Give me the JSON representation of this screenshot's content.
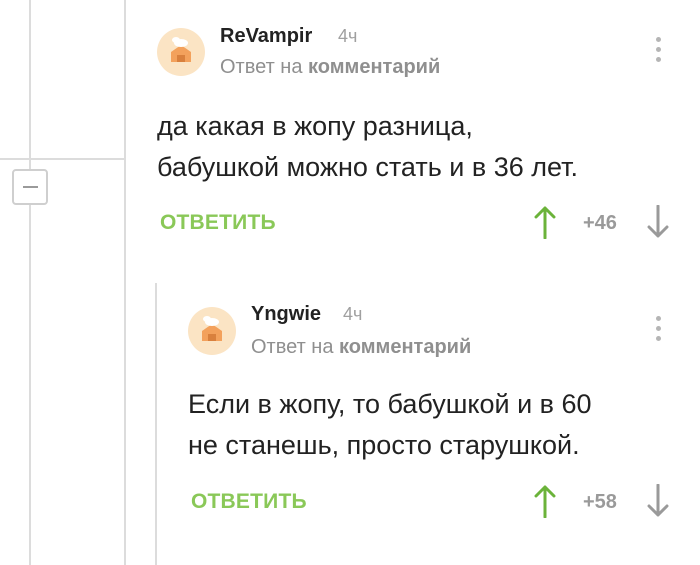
{
  "comments": [
    {
      "author": "ReVampir",
      "time": "4ч",
      "reply_prefix": "Ответ на",
      "reply_target": "комментарий",
      "text_lines": [
        "да какая в жопу разница,",
        "бабушкой можно стать и в 36 лет."
      ],
      "reply_label": "ОТВЕТИТЬ",
      "score": "+46"
    },
    {
      "author": "Yngwie",
      "time": "4ч",
      "reply_prefix": "Ответ на",
      "reply_target": "комментарий",
      "text_lines": [
        "Если в жопу, то бабушкой и в 60",
        "не станешь, просто старушкой."
      ],
      "reply_label": "ОТВЕТИТЬ",
      "score": "+58"
    }
  ],
  "colors": {
    "accent_green": "#8ac858",
    "upvote_green": "#6bb33a",
    "muted_gray": "#9a9a9a",
    "thread_line": "#dcdcdc"
  },
  "icons": {
    "avatar": "default-avatar-icon",
    "menu": "more-vertical-icon",
    "upvote": "arrow-up-icon",
    "downvote": "arrow-down-icon",
    "collapse": "minus-icon"
  }
}
